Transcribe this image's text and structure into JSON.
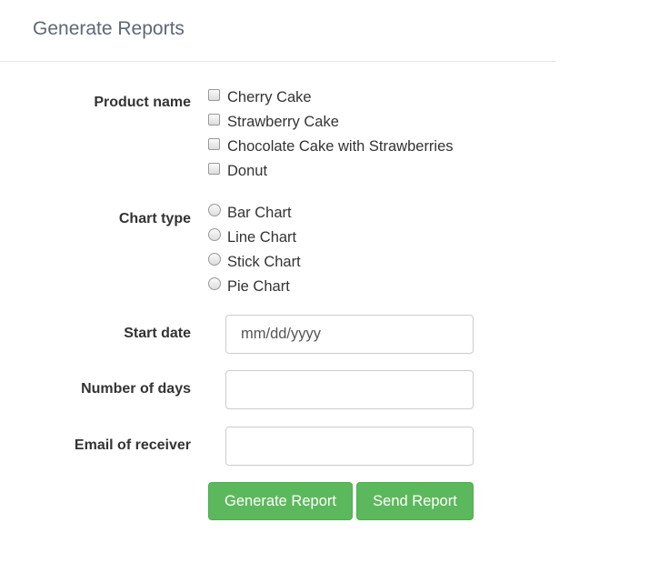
{
  "header": {
    "title": "Generate Reports"
  },
  "form": {
    "product": {
      "label": "Product name",
      "options": [
        "Cherry Cake",
        "Strawberry Cake",
        "Chocolate Cake with Strawberries",
        "Donut"
      ]
    },
    "chart": {
      "label": "Chart type",
      "options": [
        "Bar Chart",
        "Line Chart",
        "Stick Chart",
        "Pie Chart"
      ]
    },
    "start_date": {
      "label": "Start date",
      "placeholder": "mm/dd/yyyy",
      "value": ""
    },
    "days": {
      "label": "Number of days",
      "value": ""
    },
    "email": {
      "label": "Email of receiver",
      "value": ""
    },
    "generate_label": "Generate Report",
    "send_label": "Send Report"
  },
  "colors": {
    "button": "#5cb85c",
    "title": "#5f6775"
  }
}
